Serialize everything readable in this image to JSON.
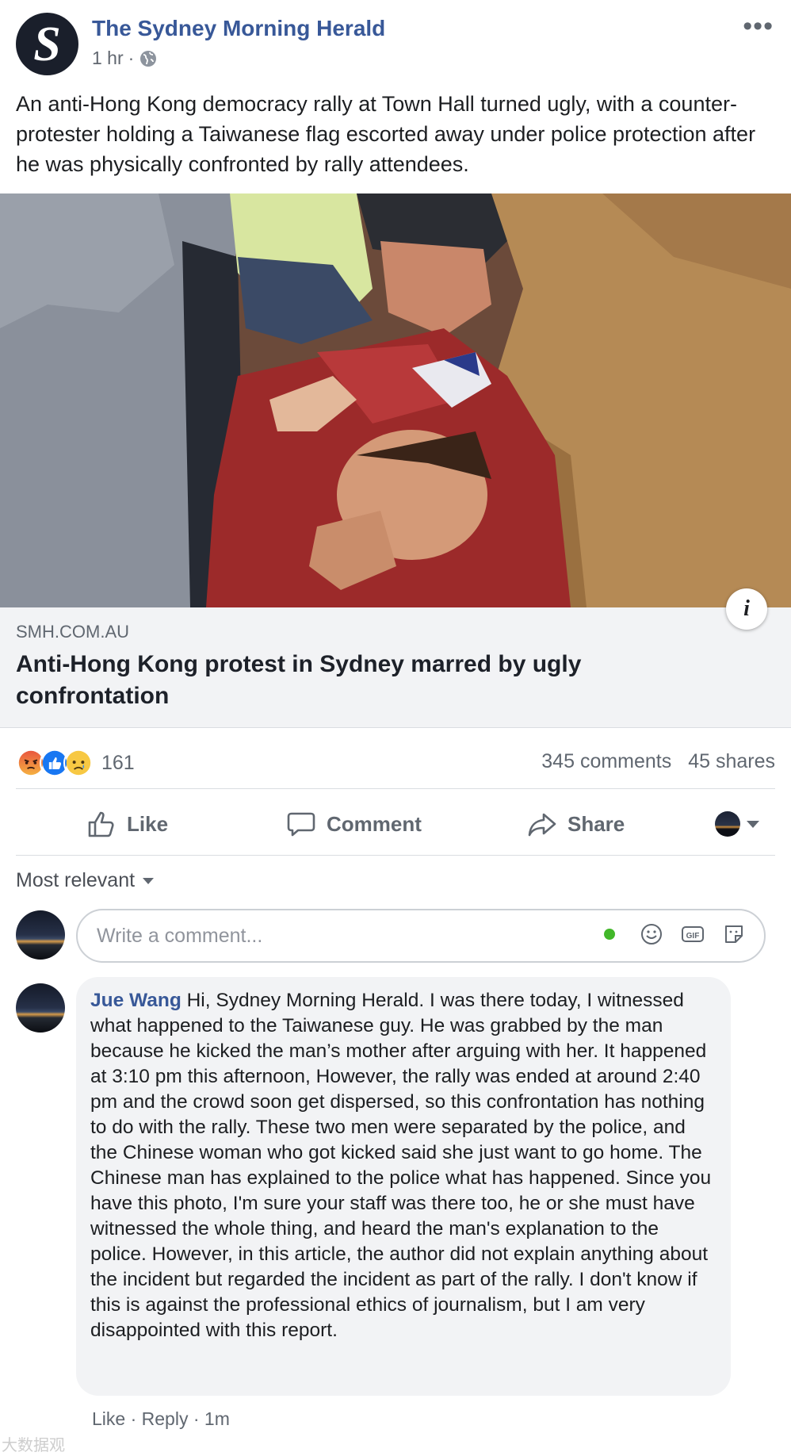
{
  "post": {
    "page_name": "The Sydney Morning Herald",
    "logo_letter": "S",
    "time": "1 hr",
    "separator": "·",
    "more_glyph": "•••",
    "caption": "An anti-Hong Kong democracy rally at Town Hall turned ugly, with a counter-protester holding a Taiwanese flag escorted away under police protection after he was physically confronted by rally attendees."
  },
  "link": {
    "domain": "SMH.COM.AU",
    "headline": "Anti-Hong Kong protest in Sydney marred by ugly confrontation",
    "info_glyph": "i"
  },
  "reactions": {
    "types": [
      "angry",
      "like",
      "sad"
    ],
    "count": "161",
    "comments": "345 comments",
    "shares": "45 shares"
  },
  "actions": {
    "like": "Like",
    "comment": "Comment",
    "share": "Share"
  },
  "comments_section": {
    "sort_label": "Most relevant",
    "composer_placeholder": "Write a comment...",
    "comment": {
      "author": "Jue Wang",
      "text": "Hi, Sydney Morning Herald. I was there today, I witnessed what happened to the Taiwanese guy. He was grabbed by the man because he kicked the man’s mother after arguing with her. It happened at 3:10 pm this afternoon, However, the rally was ended at around 2:40 pm and the crowd soon get dispersed, so this confrontation has nothing to do with the rally. These two men were separated by the police, and the Chinese woman who got kicked said she just want to go home. The Chinese man has explained to the police what has happened. Since you have this photo, I'm sure your staff was there too, he or she must have witnessed the whole thing, and heard the man's explanation to the police. However, in this article, the author did not explain anything about the incident but regarded the incident as part of the rally. I don't know if this is against the professional ethics of journalism, but I am very disappointed with this report.",
      "like": "Like",
      "reply": "Reply",
      "dot": "·",
      "time": "1m"
    },
    "watermark": "大数据观"
  },
  "colors": {
    "brand_blue": "#385898",
    "gray_text": "#606770",
    "link_bg": "#f2f3f5",
    "online": "#42b72a"
  }
}
